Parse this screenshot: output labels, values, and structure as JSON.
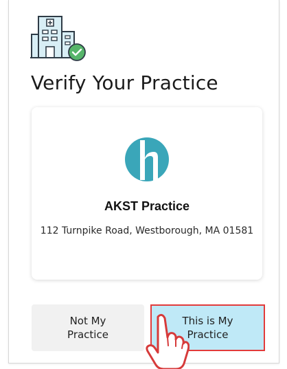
{
  "header": {
    "icon": "hospital-verified-icon",
    "title": "Verify Your Practice"
  },
  "practice": {
    "logo_icon": "practice-logo-icon",
    "name": "AKST Practice",
    "address": "112 Turnpike Road, Westborough, MA 01581"
  },
  "actions": {
    "not_my_practice_label": "Not My\nPractice",
    "this_is_my_practice_label": "This is My\nPractice"
  },
  "overlay": {
    "pointer_icon": "hand-pointer-icon"
  },
  "colors": {
    "accent_teal": "#3aa6b9",
    "verified_green": "#56b56a",
    "confirm_bg": "#bfe9f7",
    "highlight_border": "#e23b3b"
  }
}
